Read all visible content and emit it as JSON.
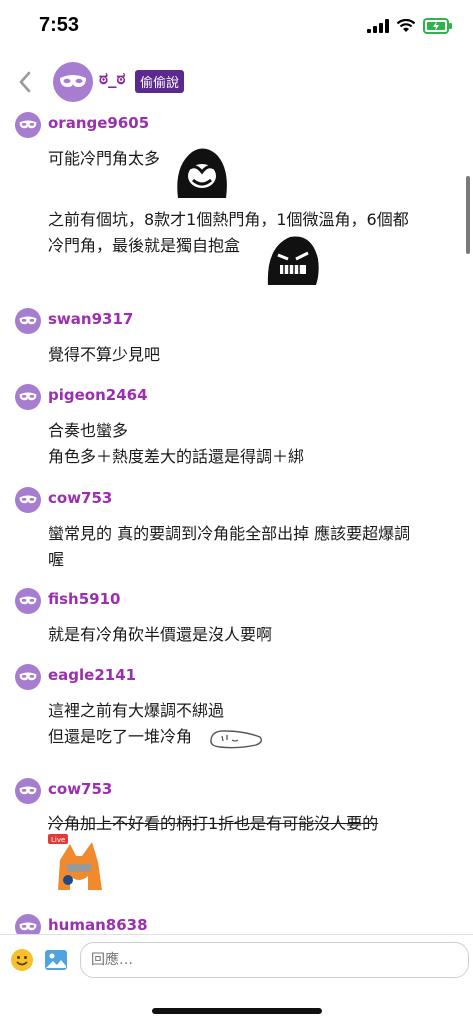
{
  "status_bar": {
    "time": "7:53",
    "battery_color": "#2fb34a"
  },
  "header": {
    "back_icon": "chevron-left-icon",
    "title": "ಠ_ಠ",
    "badge": "偷偷說",
    "accent": "#9b2fb0",
    "badge_color": "#5b2a8e"
  },
  "comments": [
    {
      "user": "orange9605",
      "lines": [
        "可能冷門角太多"
      ],
      "lines2": [
        "之前有個坑，8款才1個熱門角，1個微溫角，6個都",
        "冷門角，最後就是獨自抱盒"
      ]
    },
    {
      "user": "swan9317",
      "lines": [
        "覺得不算少見吧"
      ]
    },
    {
      "user": "pigeon2464",
      "lines": [
        "合奏也蠻多",
        "角色多＋熱度差大的話還是得調＋綁"
      ]
    },
    {
      "user": "cow753",
      "lines": [
        "蠻常見的 真的要調到冷角能全部出掉 應該要超爆調",
        "喔"
      ]
    },
    {
      "user": "fish5910",
      "lines": [
        "就是有冷角砍半價還是沒人要啊"
      ]
    },
    {
      "user": "eagle2141",
      "lines": [
        "這裡之前有大爆調不綁過",
        "但還是吃了一堆冷角"
      ]
    },
    {
      "user": "cow753",
      "lines": [
        "冷角加上不好看的柄打1折也是有可能沒人要的"
      ],
      "sticker_label": "Live"
    },
    {
      "user": "human8638",
      "lines": []
    }
  ],
  "reply": {
    "placeholder": "回應…"
  }
}
